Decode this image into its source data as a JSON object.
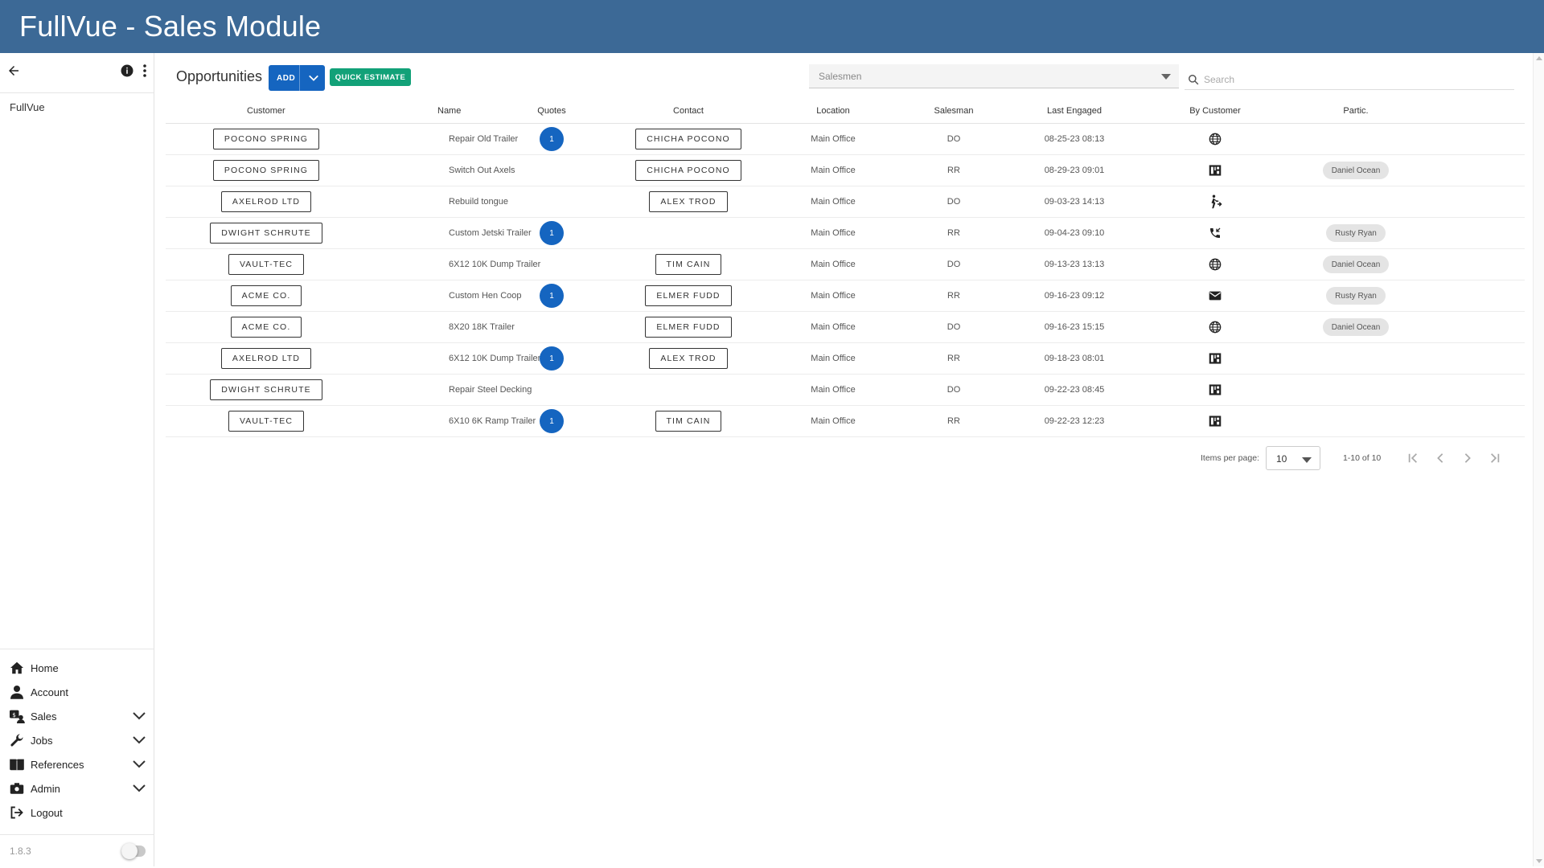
{
  "app": {
    "title": "FullVue - Sales Module"
  },
  "sidebar": {
    "brand": "FullVue",
    "version": "1.8.3",
    "nav": [
      {
        "label": "Home",
        "icon": "home-icon",
        "expandable": false
      },
      {
        "label": "Account",
        "icon": "person-icon",
        "expandable": false
      },
      {
        "label": "Sales",
        "icon": "sales-icon",
        "expandable": true
      },
      {
        "label": "Jobs",
        "icon": "wrench-icon",
        "expandable": true
      },
      {
        "label": "References",
        "icon": "book-icon",
        "expandable": true
      },
      {
        "label": "Admin",
        "icon": "admin-icon",
        "expandable": true
      },
      {
        "label": "Logout",
        "icon": "logout-icon",
        "expandable": false
      }
    ]
  },
  "toolbar": {
    "title": "Opportunities",
    "add_label": "ADD",
    "quick_label": "QUICK ESTIMATE",
    "salesmen_placeholder": "Salesmen",
    "search_placeholder": "Search"
  },
  "table": {
    "headers": {
      "customer": "Customer",
      "name": "Name",
      "quotes": "Quotes",
      "contact": "Contact",
      "location": "Location",
      "salesman": "Salesman",
      "last": "Last Engaged",
      "by": "By Customer",
      "partic": "Partic."
    },
    "rows": [
      {
        "customer": "POCONO SPRING",
        "name": "Repair Old Trailer",
        "quotes": "1",
        "contact": "CHICHA POCONO",
        "location": "Main Office",
        "salesman": "DO",
        "last": "08-25-23 08:13",
        "by": "globe-icon",
        "partic": ""
      },
      {
        "customer": "POCONO SPRING",
        "name": "Switch Out Axels",
        "quotes": "",
        "contact": "CHICHA POCONO",
        "location": "Main Office",
        "salesman": "RR",
        "last": "08-29-23 09:01",
        "by": "store-icon",
        "partic": "Daniel Ocean"
      },
      {
        "customer": "AXELROD LTD",
        "name": "Rebuild tongue",
        "quotes": "",
        "contact": "ALEX TROD",
        "location": "Main Office",
        "salesman": "DO",
        "last": "09-03-23 14:13",
        "by": "walk-in-icon",
        "partic": ""
      },
      {
        "customer": "DWIGHT SCHRUTE",
        "name": "Custom Jetski Trailer",
        "quotes": "1",
        "contact": "",
        "location": "Main Office",
        "salesman": "RR",
        "last": "09-04-23 09:10",
        "by": "phone-callback-icon",
        "partic": "Rusty Ryan"
      },
      {
        "customer": "VAULT-TEC",
        "name": "6X12 10K Dump Trailer",
        "quotes": "",
        "contact": "TIM CAIN",
        "location": "Main Office",
        "salesman": "DO",
        "last": "09-13-23 13:13",
        "by": "globe-icon",
        "partic": "Daniel Ocean"
      },
      {
        "customer": "ACME CO.",
        "name": "Custom Hen Coop",
        "quotes": "1",
        "contact": "ELMER FUDD",
        "location": "Main Office",
        "salesman": "RR",
        "last": "09-16-23 09:12",
        "by": "mail-icon",
        "partic": "Rusty Ryan"
      },
      {
        "customer": "ACME CO.",
        "name": "8X20 18K Trailer",
        "quotes": "",
        "contact": "ELMER FUDD",
        "location": "Main Office",
        "salesman": "DO",
        "last": "09-16-23 15:15",
        "by": "globe-icon",
        "partic": "Daniel Ocean"
      },
      {
        "customer": "AXELROD LTD",
        "name": "6X12 10K Dump Trailer",
        "quotes": "1",
        "contact": "ALEX TROD",
        "location": "Main Office",
        "salesman": "RR",
        "last": "09-18-23 08:01",
        "by": "store-icon",
        "partic": ""
      },
      {
        "customer": "DWIGHT SCHRUTE",
        "name": "Repair Steel Decking",
        "quotes": "",
        "contact": "",
        "location": "Main Office",
        "salesman": "DO",
        "last": "09-22-23 08:45",
        "by": "store-icon",
        "partic": ""
      },
      {
        "customer": "VAULT-TEC",
        "name": "6X10 6K Ramp Trailer",
        "quotes": "1",
        "contact": "TIM CAIN",
        "location": "Main Office",
        "salesman": "RR",
        "last": "09-22-23 12:23",
        "by": "store-icon",
        "partic": ""
      }
    ]
  },
  "pager": {
    "items_per_page_label": "Items per page:",
    "items_per_page": "10",
    "range": "1-10 of 10"
  },
  "colors": {
    "header": "#3c6996",
    "primary": "#1565c0",
    "accent": "#12a178"
  }
}
